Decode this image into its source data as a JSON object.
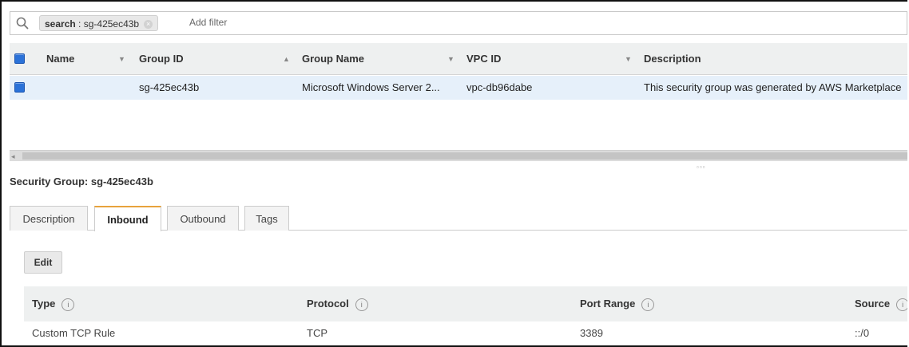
{
  "filter": {
    "chip_key": "search",
    "chip_value": "sg-425ec43b",
    "add_filter": "Add filter"
  },
  "grid": {
    "columns": [
      "Name",
      "Group ID",
      "Group Name",
      "VPC ID",
      "Description"
    ],
    "row": {
      "name": "",
      "group_id": "sg-425ec43b",
      "group_name": "Microsoft Windows Server 2...",
      "vpc_id": "vpc-db96dabe",
      "description": "This security group was generated by AWS Marketplace"
    }
  },
  "panel": {
    "title": "Security Group: sg-425ec43b",
    "tabs": [
      "Description",
      "Inbound",
      "Outbound",
      "Tags"
    ],
    "active_tab": "Inbound",
    "edit_label": "Edit"
  },
  "rules": {
    "headers": [
      "Type",
      "Protocol",
      "Port Range",
      "Source"
    ],
    "rows": [
      {
        "type": "Custom TCP Rule",
        "protocol": "TCP",
        "port_range": "3389",
        "source": "::/0"
      }
    ]
  },
  "colors": {
    "accent_tab": "#e8a33d",
    "checkbox": "#2b72d8",
    "selected_row": "#e6f0fa"
  }
}
